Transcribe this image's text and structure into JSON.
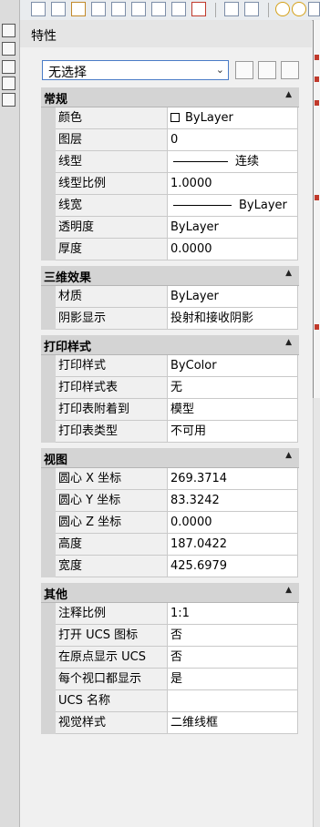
{
  "toolbar": {
    "icons": [
      "select-icon",
      "zoom-icon",
      "pencil-icon",
      "refresh-icon",
      "arc-icon",
      "zoom-window-icon",
      "zoom-previous-icon",
      "layer-icon",
      "close-doc-icon",
      "grid-icon",
      "edit-icon",
      "light-bulb-icon",
      "sun-icon",
      "lock-icon"
    ]
  },
  "palette": {
    "title": "特性",
    "selector": {
      "value": "无选择",
      "arrow": "⌄"
    },
    "sections": [
      {
        "key": "general",
        "title": "常规",
        "rows": [
          {
            "name": "颜色",
            "value": "ByLayer",
            "kind": "color"
          },
          {
            "name": "图层",
            "value": "0"
          },
          {
            "name": "线型",
            "value": "连续",
            "kind": "linetype"
          },
          {
            "name": "线型比例",
            "value": "1.0000"
          },
          {
            "name": "线宽",
            "value": "ByLayer",
            "kind": "lineweight"
          },
          {
            "name": "透明度",
            "value": "ByLayer"
          },
          {
            "name": "厚度",
            "value": "0.0000"
          }
        ]
      },
      {
        "key": "3d",
        "title": "三维效果",
        "rows": [
          {
            "name": "材质",
            "value": "ByLayer"
          },
          {
            "name": "阴影显示",
            "value": "投射和接收阴影"
          }
        ]
      },
      {
        "key": "plot",
        "title": "打印样式",
        "rows": [
          {
            "name": "打印样式",
            "value": "ByColor"
          },
          {
            "name": "打印样式表",
            "value": "无"
          },
          {
            "name": "打印表附着到",
            "value": "模型"
          },
          {
            "name": "打印表类型",
            "value": "不可用"
          }
        ]
      },
      {
        "key": "view",
        "title": "视图",
        "rows": [
          {
            "name": "圆心 X 坐标",
            "value": "269.3714"
          },
          {
            "name": "圆心 Y 坐标",
            "value": "83.3242"
          },
          {
            "name": "圆心 Z 坐标",
            "value": "0.0000"
          },
          {
            "name": "高度",
            "value": "187.0422"
          },
          {
            "name": "宽度",
            "value": "425.6979"
          }
        ]
      },
      {
        "key": "misc",
        "title": "其他",
        "rows": [
          {
            "name": "注释比例",
            "value": "1:1"
          },
          {
            "name": "打开 UCS 图标",
            "value": "否"
          },
          {
            "name": "在原点显示 UCS",
            "value": "否"
          },
          {
            "name": "每个视口都显示",
            "value": "是"
          },
          {
            "name": "UCS 名称",
            "value": ""
          },
          {
            "name": "视觉样式",
            "value": "二维线框"
          }
        ]
      }
    ],
    "collapse_glyph": "▲"
  },
  "colors": {
    "accent_border": "#4a7cc7",
    "section_bg": "#d4d4d4",
    "value_bg": "#ffffff"
  }
}
